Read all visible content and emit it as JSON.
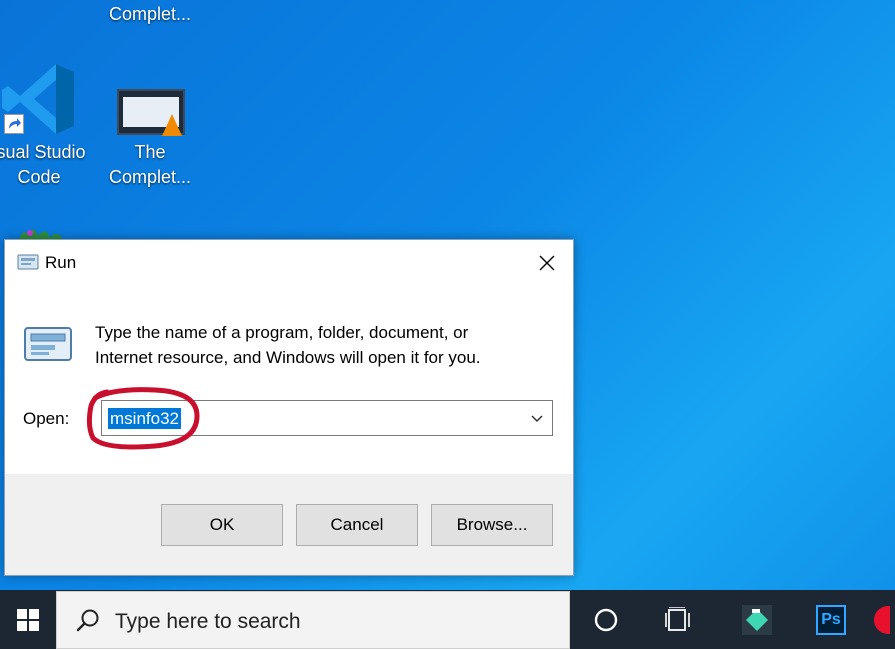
{
  "desktop": {
    "icons": [
      {
        "name": "Complet...",
        "label_line2": ""
      },
      {
        "name": "isual Studio",
        "label_line2": "Code"
      },
      {
        "name": "The",
        "label_line2": "Complet..."
      }
    ]
  },
  "run_dialog": {
    "title": "Run",
    "description_line1": "Type the name of a program, folder, document, or",
    "description_line2": "Internet resource, and Windows will open it for you.",
    "open_label": "Open:",
    "open_value": "msinfo32",
    "buttons": {
      "ok": "OK",
      "cancel": "Cancel",
      "browse": "Browse..."
    }
  },
  "taskbar": {
    "search_placeholder": "Type here to search",
    "pinned": [
      "cortana-icon",
      "task-view-icon",
      "filmora-icon",
      "photoshop-icon"
    ],
    "photoshop_label": "Ps"
  },
  "colors": {
    "desktop_blue": "#0b86e6",
    "selection": "#0078d7",
    "annotation_red": "#c8102e",
    "taskbar": "#1c2733"
  }
}
